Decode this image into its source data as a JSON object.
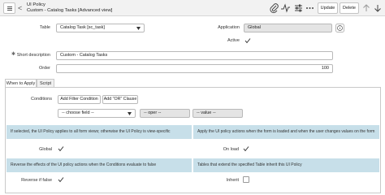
{
  "header": {
    "title": "UI Policy",
    "subtitle": "Custom - Catalog Tasks [Advanced view]",
    "back_glyph": "<",
    "update_label": "Update",
    "delete_label": "Delete",
    "icons": [
      "paperclip-icon",
      "activity-icon",
      "settings-sliders-icon",
      "more-icon",
      "up-arrow-icon",
      "down-arrow-icon"
    ]
  },
  "form": {
    "table_label": "Table",
    "table_value": "Catalog Task [sc_task]",
    "application_label": "Application",
    "application_value": "Global",
    "active_label": "Active",
    "short_description_label": "Short description",
    "short_description_value": "Custom - Catalog Tasks",
    "order_label": "Order",
    "order_value": "100"
  },
  "tabs": [
    {
      "label": "When to Apply",
      "active": true
    },
    {
      "label": "Script",
      "active": false
    }
  ],
  "when_to_apply": {
    "conditions_label": "Conditions",
    "add_filter_label": "Add Filter Condition",
    "add_or_label": "Add \"OR\" Clause",
    "field_placeholder": "-- choose field --",
    "oper_placeholder": "-- oper --",
    "value_placeholder": "-- value --",
    "info_global": "If selected, the UI Policy applies to all form views; otherwise the UI Policy is view-specific",
    "info_onload": "Apply the UI policy actions when the form is loaded and when the user changes values on the form",
    "global_label": "Global",
    "onload_label": "On load",
    "info_reverse": "Reverse the effects of the UI policy actions when the Conditions evaluate to false",
    "info_inherit": "Tables that extend the specified Table inherit this UI Policy",
    "reverse_label": "Reverse if false",
    "inherit_label": "Inherit"
  },
  "colors": {
    "header_bg": "#f2f2f2",
    "info_bg": "#c7dfe9",
    "readonly_bg": "#e4e4e4"
  }
}
